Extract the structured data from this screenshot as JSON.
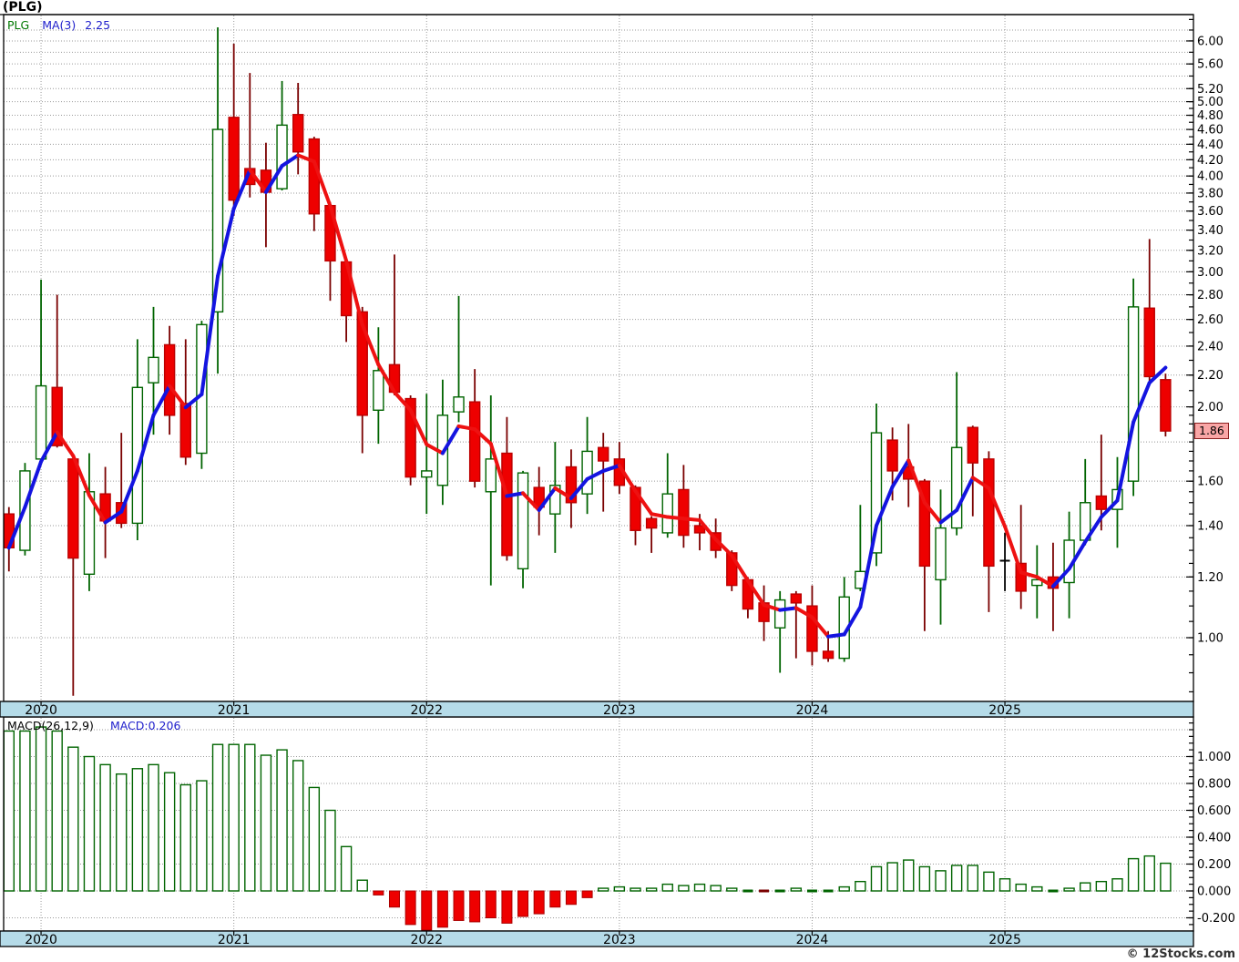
{
  "window": {
    "title": "(PLG)"
  },
  "price_panel": {
    "legend": {
      "symbol": "PLG",
      "ma_label": "MA(3)",
      "ma_value": "2.25"
    },
    "last_price_badge": "1.86",
    "y_axis": {
      "labels": [
        "6.00",
        "5.60",
        "5.20",
        "5.00",
        "4.80",
        "4.60",
        "4.40",
        "4.20",
        "4.00",
        "3.80",
        "3.60",
        "3.40",
        "3.20",
        "3.00",
        "2.80",
        "2.60",
        "2.40",
        "2.20",
        "2.00",
        "1.60",
        "1.40",
        "1.20",
        "1.00"
      ],
      "values": [
        6.0,
        5.6,
        5.2,
        5.0,
        4.8,
        4.6,
        4.4,
        4.2,
        4.0,
        3.8,
        3.6,
        3.4,
        3.2,
        3.0,
        2.8,
        2.6,
        2.4,
        2.2,
        2.0,
        1.6,
        1.4,
        1.2,
        1.0
      ]
    }
  },
  "macd_panel": {
    "legend": {
      "left": "MACD(26,12,9)",
      "right": "MACD:0.206"
    },
    "y_axis": {
      "labels": [
        "1.000",
        "0.800",
        "0.600",
        "0.400",
        "0.200",
        "0.000",
        "-0.200"
      ],
      "values": [
        1.0,
        0.8,
        0.6,
        0.4,
        0.2,
        0.0,
        -0.2
      ]
    }
  },
  "x_axis": {
    "years": [
      "2020",
      "2021",
      "2022",
      "2023",
      "2024",
      "2025"
    ]
  },
  "footer": {
    "copyright": "© 12Stocks.com"
  },
  "colors": {
    "up_outline": "#006400",
    "down_fill": "#ee0000",
    "down_wick": "#7a0000",
    "down_border": "#bb0000",
    "doji": "#000000",
    "ma_up": "#1414e0",
    "ma_down": "#ee1111",
    "grid": "#999999",
    "band_fill": "#b5dbe8",
    "badge_bg": "#f9a6a6",
    "badge_border": "#8b2020"
  },
  "chart_data": [
    {
      "type": "candlestick",
      "title": "PLG monthly candlesticks with MA(3) overlay",
      "y_scale": "log",
      "ylim": [
        0.83,
        6.45
      ],
      "legend_position": "top-left",
      "grid": true,
      "last_price": 1.86,
      "x": [
        "2019-11",
        "2019-12",
        "2020-01",
        "2020-02",
        "2020-03",
        "2020-04",
        "2020-05",
        "2020-06",
        "2020-07",
        "2020-08",
        "2020-09",
        "2020-10",
        "2020-11",
        "2020-12",
        "2021-01",
        "2021-02",
        "2021-03",
        "2021-04",
        "2021-05",
        "2021-06",
        "2021-07",
        "2021-08",
        "2021-09",
        "2021-10",
        "2021-11",
        "2021-12",
        "2022-01",
        "2022-02",
        "2022-03",
        "2022-04",
        "2022-05",
        "2022-06",
        "2022-07",
        "2022-08",
        "2022-09",
        "2022-10",
        "2022-11",
        "2022-12",
        "2023-01",
        "2023-02",
        "2023-03",
        "2023-04",
        "2023-05",
        "2023-06",
        "2023-07",
        "2023-08",
        "2023-09",
        "2023-10",
        "2023-11",
        "2023-12",
        "2024-01",
        "2024-02",
        "2024-03",
        "2024-04",
        "2024-05",
        "2024-06",
        "2024-07",
        "2024-08",
        "2024-09",
        "2024-10",
        "2024-11",
        "2024-12",
        "2025-01",
        "2025-02",
        "2025-03",
        "2025-04",
        "2025-05",
        "2025-06",
        "2025-07",
        "2025-08",
        "2025-09",
        "2025-10",
        "2025-11"
      ],
      "ohlc": [
        [
          1.45,
          1.48,
          1.22,
          1.31
        ],
        [
          1.3,
          1.69,
          1.28,
          1.65
        ],
        [
          1.71,
          2.93,
          1.68,
          2.13
        ],
        [
          2.12,
          2.8,
          1.77,
          1.78
        ],
        [
          1.71,
          1.72,
          0.84,
          1.27
        ],
        [
          1.21,
          1.74,
          1.15,
          1.55
        ],
        [
          1.54,
          1.67,
          1.27,
          1.42
        ],
        [
          1.5,
          1.85,
          1.39,
          1.41
        ],
        [
          1.41,
          2.45,
          1.34,
          2.12
        ],
        [
          2.15,
          2.7,
          1.84,
          2.32
        ],
        [
          2.41,
          2.55,
          1.84,
          1.95
        ],
        [
          2.02,
          2.45,
          1.68,
          1.72
        ],
        [
          1.74,
          2.59,
          1.66,
          2.56
        ],
        [
          2.66,
          6.25,
          2.21,
          4.6
        ],
        [
          4.77,
          5.95,
          3.55,
          3.72
        ],
        [
          4.09,
          5.45,
          3.75,
          3.9
        ],
        [
          4.07,
          4.42,
          3.23,
          3.81
        ],
        [
          3.85,
          5.32,
          3.83,
          4.66
        ],
        [
          4.81,
          5.29,
          4.02,
          4.3
        ],
        [
          4.47,
          4.5,
          3.39,
          3.57
        ],
        [
          3.66,
          3.7,
          2.75,
          3.1
        ],
        [
          3.09,
          3.1,
          2.43,
          2.63
        ],
        [
          2.66,
          2.7,
          1.74,
          1.95
        ],
        [
          1.98,
          2.54,
          1.79,
          2.23
        ],
        [
          2.27,
          3.16,
          2.07,
          2.09
        ],
        [
          2.05,
          2.07,
          1.58,
          1.62
        ],
        [
          1.62,
          2.08,
          1.45,
          1.65
        ],
        [
          1.58,
          2.17,
          1.49,
          1.95
        ],
        [
          1.97,
          2.79,
          1.91,
          2.06
        ],
        [
          2.03,
          2.24,
          1.57,
          1.6
        ],
        [
          1.55,
          2.07,
          1.17,
          1.71
        ],
        [
          1.74,
          1.94,
          1.26,
          1.28
        ],
        [
          1.23,
          1.65,
          1.16,
          1.64
        ],
        [
          1.57,
          1.67,
          1.36,
          1.48
        ],
        [
          1.45,
          1.8,
          1.29,
          1.58
        ],
        [
          1.67,
          1.76,
          1.39,
          1.5
        ],
        [
          1.54,
          1.94,
          1.45,
          1.75
        ],
        [
          1.77,
          1.85,
          1.46,
          1.7
        ],
        [
          1.71,
          1.8,
          1.54,
          1.58
        ],
        [
          1.57,
          1.58,
          1.32,
          1.38
        ],
        [
          1.43,
          1.44,
          1.29,
          1.39
        ],
        [
          1.37,
          1.74,
          1.35,
          1.54
        ],
        [
          1.56,
          1.68,
          1.31,
          1.36
        ],
        [
          1.4,
          1.45,
          1.3,
          1.37
        ],
        [
          1.37,
          1.43,
          1.27,
          1.3
        ],
        [
          1.29,
          1.3,
          1.15,
          1.17
        ],
        [
          1.19,
          1.2,
          1.06,
          1.09
        ],
        [
          1.11,
          1.17,
          0.99,
          1.05
        ],
        [
          1.03,
          1.15,
          0.9,
          1.12
        ],
        [
          1.14,
          1.15,
          0.94,
          1.11
        ],
        [
          1.1,
          1.17,
          0.92,
          0.96
        ],
        [
          0.96,
          1.02,
          0.93,
          0.94
        ],
        [
          0.94,
          1.2,
          0.93,
          1.13
        ],
        [
          1.16,
          1.49,
          1.15,
          1.22
        ],
        [
          1.29,
          2.02,
          1.24,
          1.85
        ],
        [
          1.81,
          1.88,
          1.51,
          1.65
        ],
        [
          1.67,
          1.9,
          1.48,
          1.61
        ],
        [
          1.6,
          1.61,
          1.02,
          1.24
        ],
        [
          1.19,
          1.56,
          1.04,
          1.39
        ],
        [
          1.39,
          2.22,
          1.36,
          1.77
        ],
        [
          1.88,
          1.89,
          1.44,
          1.69
        ],
        [
          1.71,
          1.75,
          1.08,
          1.24
        ],
        [
          1.26,
          1.37,
          1.15,
          1.26
        ],
        [
          1.25,
          1.49,
          1.09,
          1.15
        ],
        [
          1.17,
          1.32,
          1.06,
          1.19
        ],
        [
          1.2,
          1.33,
          1.02,
          1.16
        ],
        [
          1.18,
          1.46,
          1.06,
          1.34
        ],
        [
          1.34,
          1.71,
          1.32,
          1.5
        ],
        [
          1.53,
          1.84,
          1.38,
          1.47
        ],
        [
          1.47,
          1.72,
          1.31,
          1.56
        ],
        [
          1.6,
          2.94,
          1.53,
          2.7
        ],
        [
          2.69,
          3.31,
          2.15,
          2.19
        ],
        [
          2.17,
          2.21,
          1.83,
          1.86
        ]
      ],
      "overlay": {
        "name": "MA(3)",
        "period": 3,
        "last_value": 2.25,
        "up_color": "#1414e0",
        "down_color": "#ee1111"
      }
    },
    {
      "type": "bar",
      "title": "MACD(26,12,9)",
      "aligned_with": "price chart months (same x)",
      "ylim": [
        -0.3,
        1.29
      ],
      "grid": true,
      "last_value": 0.206,
      "values": [
        1.19,
        1.19,
        1.22,
        1.19,
        1.07,
        1.0,
        0.94,
        0.87,
        0.91,
        0.94,
        0.88,
        0.79,
        0.82,
        1.09,
        1.09,
        1.09,
        1.01,
        1.05,
        0.97,
        0.77,
        0.6,
        0.33,
        0.08,
        -0.03,
        -0.12,
        -0.25,
        -0.3,
        -0.27,
        -0.22,
        -0.23,
        -0.2,
        -0.24,
        -0.19,
        -0.17,
        -0.12,
        -0.1,
        -0.05,
        0.02,
        0.03,
        0.02,
        0.02,
        0.05,
        0.04,
        0.05,
        0.04,
        0.02,
        0.0,
        -0.01,
        0.0,
        0.02,
        0.0,
        0.0,
        0.03,
        0.07,
        0.18,
        0.21,
        0.23,
        0.18,
        0.15,
        0.19,
        0.19,
        0.14,
        0.09,
        0.05,
        0.03,
        0.0,
        0.02,
        0.06,
        0.07,
        0.09,
        0.24,
        0.26,
        0.206
      ]
    }
  ]
}
